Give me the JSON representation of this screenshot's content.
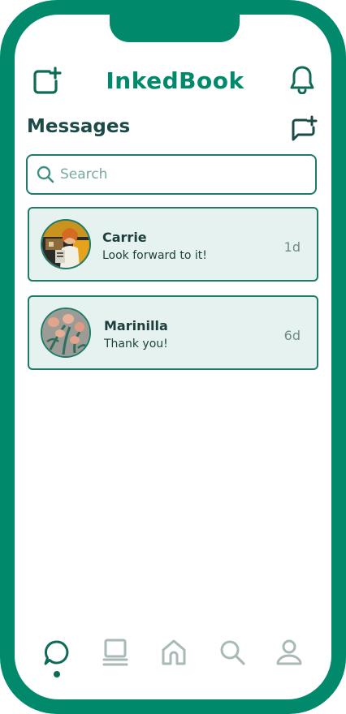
{
  "brand": {
    "name": "InkedBook"
  },
  "header": {
    "title": "Messages"
  },
  "search": {
    "placeholder": "Search",
    "value": ""
  },
  "conversations": [
    {
      "name": "Carrie",
      "preview": "Look forward to it!",
      "time": "1d"
    },
    {
      "name": "Marinilla",
      "preview": "Thank you!",
      "time": "6d"
    }
  ],
  "icons": {
    "new_post": "square-plus-icon",
    "notifications": "bell-icon",
    "new_message": "chat-plus-icon",
    "search": "search-icon"
  },
  "nav": {
    "items": [
      {
        "name": "chat",
        "icon": "chat-bubble-icon",
        "active": true
      },
      {
        "name": "gallery",
        "icon": "book-stack-icon",
        "active": false
      },
      {
        "name": "home",
        "icon": "home-icon",
        "active": false
      },
      {
        "name": "search",
        "icon": "search-icon",
        "active": false
      },
      {
        "name": "profile",
        "icon": "user-icon",
        "active": false
      }
    ]
  },
  "colors": {
    "brand": "#008a6b",
    "border": "#1f7a68",
    "card_bg": "#e6f2f0",
    "text_dark": "#1c3f3b",
    "text_muted": "#6f8a87",
    "nav_inactive": "#a9b9b7"
  }
}
